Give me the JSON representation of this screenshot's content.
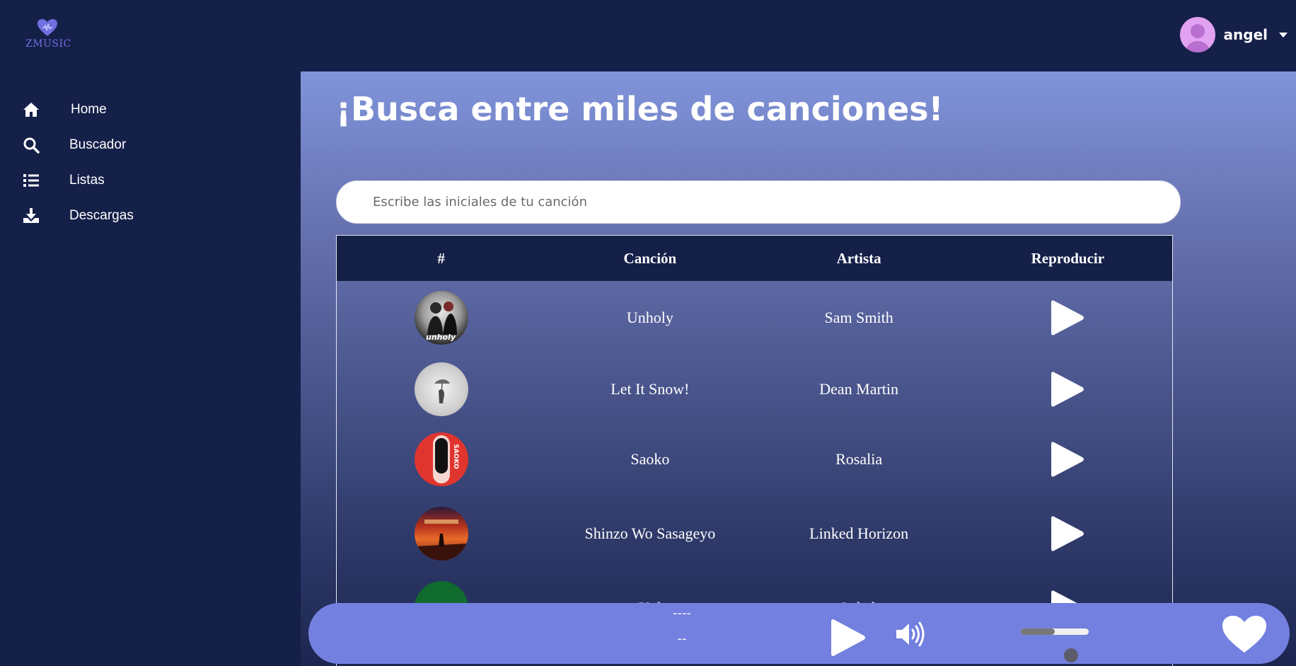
{
  "app": {
    "logo_text": "ZMUSIC"
  },
  "user": {
    "name": "angel"
  },
  "sidebar": {
    "items": [
      {
        "label": "Home",
        "icon": "home-icon"
      },
      {
        "label": "Buscador",
        "icon": "search-icon"
      },
      {
        "label": "Listas",
        "icon": "list-icon"
      },
      {
        "label": "Descargas",
        "icon": "download-icon"
      }
    ]
  },
  "main": {
    "title": "¡Busca entre miles de canciones!",
    "search": {
      "placeholder": "Escribe las iniciales de tu canción",
      "value": ""
    },
    "table": {
      "headers": [
        "#",
        "Canción",
        "Artista",
        "Reproducir"
      ],
      "rows": [
        {
          "song": "Unholy",
          "artist": "Sam Smith",
          "cover_label": "unholy"
        },
        {
          "song": "Let It Snow!",
          "artist": "Dean Martin"
        },
        {
          "song": "Saoko",
          "artist": "Rosalia",
          "cover_label": "SAOKO"
        },
        {
          "song": "Shinzo Wo Sasageyo",
          "artist": "Linked Horizon"
        },
        {
          "song": "Kal",
          "artist": "Ocheh"
        }
      ]
    }
  },
  "player": {
    "title": "----",
    "artist": "--",
    "volume_level": 0.5
  },
  "colors": {
    "navy": "#152049",
    "accent": "#7380df",
    "brand_purple": "#6f6fe0"
  }
}
